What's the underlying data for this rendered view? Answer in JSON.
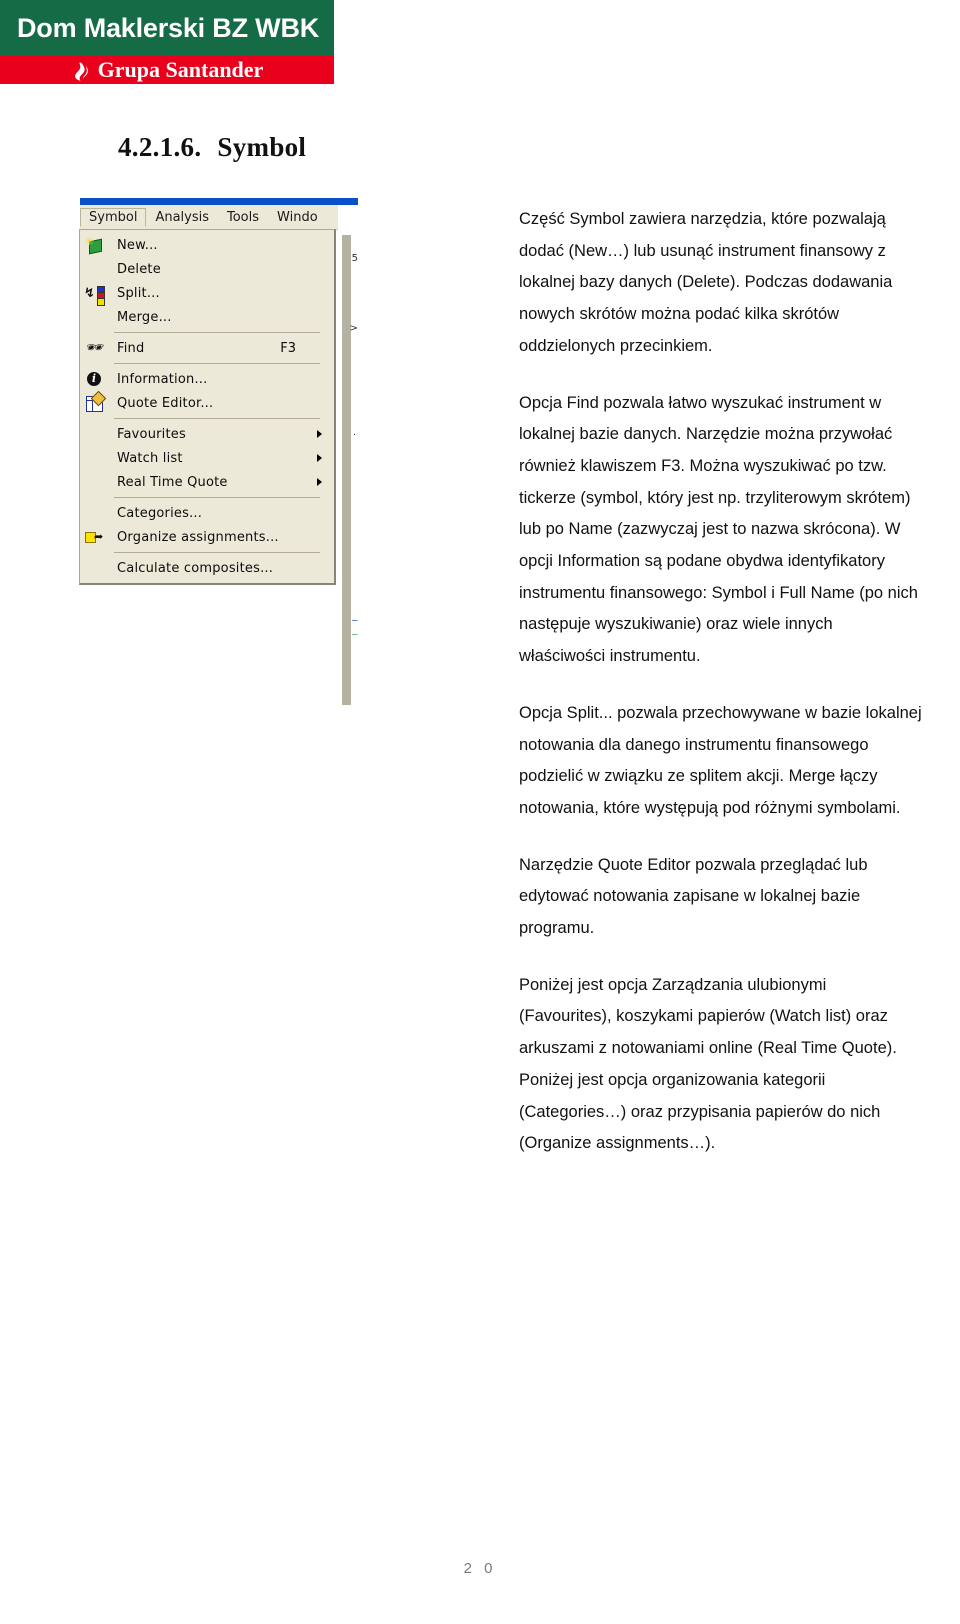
{
  "brand": {
    "bank_name": "Dom Maklerski BZ WBK",
    "group_name": "Grupa Santander",
    "green_hex": "#156b45",
    "red_hex": "#e8001c",
    "flame_icon": "santander-flame-icon"
  },
  "section": {
    "number": "4.2.1.6.",
    "title": "Symbol"
  },
  "screenshot": {
    "menubar": [
      {
        "label": "Symbol",
        "selected": true
      },
      {
        "label": "Analysis",
        "selected": false
      },
      {
        "label": "Tools",
        "selected": false
      },
      {
        "label": "Windo",
        "selected": false
      }
    ],
    "dropdown_items": [
      {
        "type": "item",
        "label": "New...",
        "icon": "new-symbol-icon",
        "accel": "",
        "submenu": false
      },
      {
        "type": "item",
        "label": "Delete",
        "icon": "",
        "accel": "",
        "submenu": false
      },
      {
        "type": "item",
        "label": "Split...",
        "icon": "split-icon",
        "accel": "",
        "submenu": false
      },
      {
        "type": "item",
        "label": "Merge...",
        "icon": "",
        "accel": "",
        "submenu": false
      },
      {
        "type": "separator"
      },
      {
        "type": "item",
        "label": "Find",
        "icon": "binoculars-icon",
        "accel": "F3",
        "submenu": false
      },
      {
        "type": "separator"
      },
      {
        "type": "item",
        "label": "Information...",
        "icon": "info-circle-icon",
        "accel": "",
        "submenu": false
      },
      {
        "type": "item",
        "label": "Quote Editor...",
        "icon": "quote-editor-grid-icon",
        "accel": "",
        "submenu": false
      },
      {
        "type": "separator"
      },
      {
        "type": "item",
        "label": "Favourites",
        "icon": "",
        "accel": "",
        "submenu": true
      },
      {
        "type": "item",
        "label": "Watch list",
        "icon": "",
        "accel": "",
        "submenu": true
      },
      {
        "type": "item",
        "label": "Real Time Quote",
        "icon": "",
        "accel": "",
        "submenu": true
      },
      {
        "type": "separator"
      },
      {
        "type": "item",
        "label": "Categories...",
        "icon": "",
        "accel": "",
        "submenu": false
      },
      {
        "type": "item",
        "label": "Organize assignments...",
        "icon": "organize-assignments-icon",
        "accel": "",
        "submenu": false
      },
      {
        "type": "separator"
      },
      {
        "type": "item",
        "label": "Calculate composites...",
        "icon": "",
        "accel": "",
        "submenu": false
      }
    ],
    "titlebar_color": "#0a50c8",
    "menu_background": "#ece9d8"
  },
  "body_text": {
    "paragraphs": [
      "Część Symbol zawiera narzędzia, które pozwalają dodać (New…) lub usunąć instrument finansowy z lokalnej bazy danych (Delete). Podczas dodawania nowych skrótów można podać kilka skrótów oddzielonych przecinkiem.",
      "Opcja Find pozwala łatwo wyszukać instrument w lokalnej bazie danych. Narzędzie można przywołać również klawiszem F3. Można wyszukiwać po tzw. tickerze (symbol, który jest np. trzyliterowym skrótem) lub po Name (zazwyczaj jest to nazwa skrócona). W opcji Information są podane obydwa identyfikatory instrumentu finansowego: Symbol i Full Name (po nich następuje wyszukiwanie) oraz wiele innych właściwości instrumentu.",
      "Opcja Split... pozwala przechowywane w bazie lokalnej notowania dla danego instrumentu finansowego podzielić w związku ze splitem akcji. Merge łączy notowania, które występują pod różnymi symbolami.",
      "Narzędzie Quote Editor pozwala przeglądać lub edytować notowania zapisane w lokalnej bazie programu.",
      "Poniżej jest opcja Zarządzania ulubionymi (Favourites), koszykami papierów (Watch list) oraz arkuszami z notowaniami online (Real Time Quote). Poniżej jest opcja organizowania kategorii (Categories…) oraz przypisania papierów do nich (Organize assignments…)."
    ]
  },
  "footer": {
    "page_number": "2 0"
  }
}
